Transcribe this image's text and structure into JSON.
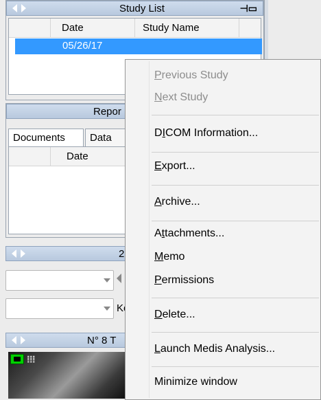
{
  "study_list": {
    "title": "Study List",
    "columns": [
      "Date",
      "Study Name"
    ],
    "rows": [
      {
        "date": "05/26/17"
      }
    ]
  },
  "reports": {
    "title": "Repor",
    "tabs": [
      "Documents",
      "Data"
    ],
    "columns": [
      "Date"
    ]
  },
  "series_panel": {
    "title_fragment": "2",
    "keyword_fragment": "Ke"
  },
  "thumbs_panel": {
    "title": "N° 8 T"
  },
  "context_menu": {
    "items": [
      {
        "label": "Previous Study",
        "enabled": false,
        "accel": "P"
      },
      {
        "label": "Next Study",
        "enabled": false,
        "accel": "N"
      },
      {
        "label": "DICOM Information...",
        "enabled": true,
        "accel": "I"
      },
      {
        "label": "Export...",
        "enabled": true,
        "accel": "E"
      },
      {
        "label": "Archive...",
        "enabled": true,
        "accel": "A"
      },
      {
        "label": "Attachments...",
        "enabled": true,
        "accel": "t"
      },
      {
        "label": "Memo",
        "enabled": true,
        "accel": "M"
      },
      {
        "label": "Permissions",
        "enabled": true,
        "accel": "P"
      },
      {
        "label": "Delete...",
        "enabled": true,
        "accel": "D"
      },
      {
        "label": "Launch Medis Analysis...",
        "enabled": true,
        "accel": "L"
      },
      {
        "label": "Minimize window",
        "enabled": true,
        "accel": ""
      }
    ]
  },
  "colors": {
    "header_blue": "#b8c9de",
    "selected_row": "#3399ff",
    "thumb_badge": "#00d000"
  }
}
